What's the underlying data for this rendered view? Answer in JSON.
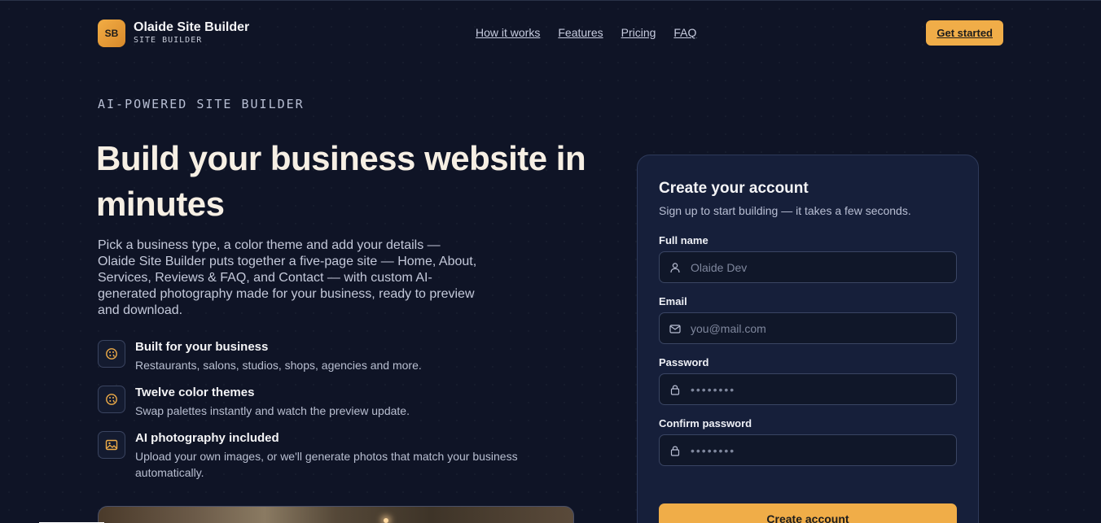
{
  "header": {
    "logo_initials": "SB",
    "brand_name": "Olaide Site Builder",
    "brand_sub": "SITE BUILDER",
    "nav": [
      {
        "label": "How it works"
      },
      {
        "label": "Features"
      },
      {
        "label": "Pricing"
      },
      {
        "label": "FAQ"
      }
    ],
    "cta_label": "Get started"
  },
  "hero": {
    "kicker": "AI-POWERED SITE BUILDER",
    "headline": "Build your business website in minutes",
    "lede": "Pick a business type, a color theme and add your details — Olaide Site Builder puts together a five-page site — Home, About, Services, Reviews & FAQ, and Contact — with custom AI-generated photography made for your business, ready to preview and download.",
    "features": [
      {
        "icon": "palette-icon",
        "title": "Built for your business",
        "desc": "Restaurants, salons, studios, shops, agencies and more."
      },
      {
        "icon": "palette-icon",
        "title": "Twelve color themes",
        "desc": "Swap palettes instantly and watch the preview update."
      },
      {
        "icon": "image-icon",
        "title": "AI photography included",
        "desc": "Upload your own images, or we'll generate photos that match your business automatically."
      }
    ]
  },
  "signup": {
    "title": "Create your account",
    "subtitle": "Sign up to start building — it takes a few seconds.",
    "fields": [
      {
        "label": "Full name",
        "icon": "user-icon",
        "placeholder": "Olaide Dev"
      },
      {
        "label": "Email",
        "icon": "mail-icon",
        "placeholder": "you@mail.com"
      },
      {
        "label": "Password",
        "icon": "lock-icon",
        "placeholder": "••••••••"
      },
      {
        "label": "Confirm password",
        "icon": "lock-icon",
        "placeholder": "••••••••"
      }
    ],
    "submit_label": "Create account"
  },
  "colors": {
    "background": "#0f1426",
    "accent": "#f0ad48",
    "card": "#161f3a",
    "headline": "#f6efe4"
  }
}
